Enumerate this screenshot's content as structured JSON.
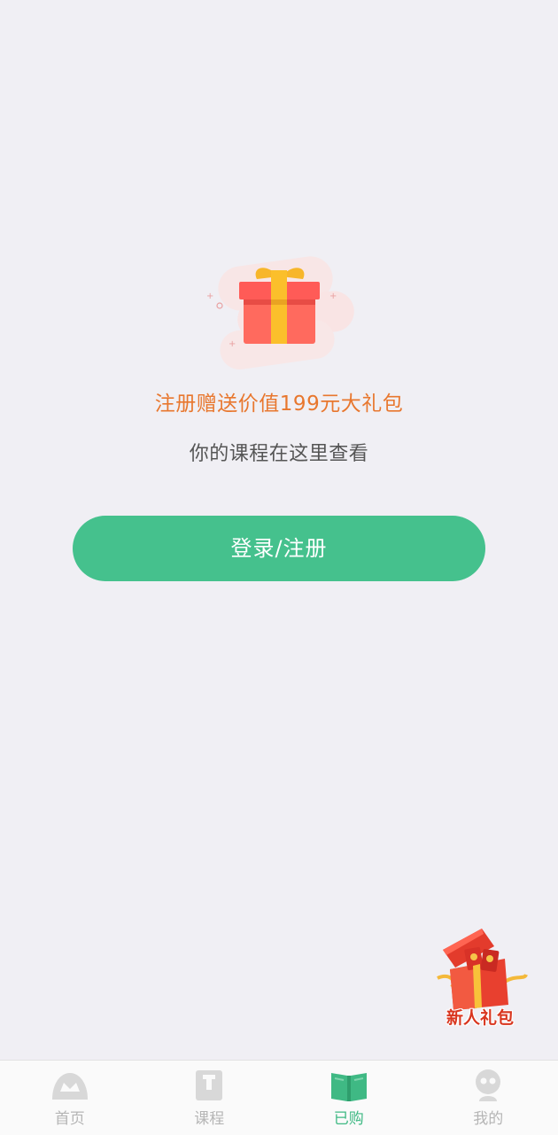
{
  "empty_state": {
    "promo_text": "注册赠送价值199元大礼包",
    "hint_text": "你的课程在这里查看",
    "login_button_label": "登录/注册",
    "illustration_icon": "gift-box-icon"
  },
  "floating_gift": {
    "label": "新人礼包",
    "icon": "red-gift-box-icon"
  },
  "tab_bar": {
    "active_index": 2,
    "tabs": [
      {
        "label": "首页",
        "icon": "home-icon"
      },
      {
        "label": "课程",
        "icon": "course-book-icon"
      },
      {
        "label": "已购",
        "icon": "open-book-icon"
      },
      {
        "label": "我的",
        "icon": "profile-icon"
      }
    ]
  },
  "colors": {
    "background": "#f0eff4",
    "accent_green": "#45c18d",
    "promo_orange": "#e8772e",
    "tab_inactive": "#b5b5b5"
  }
}
